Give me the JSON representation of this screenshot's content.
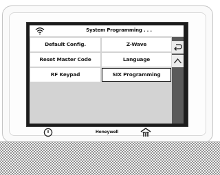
{
  "status_bar": {
    "title": "System Programming . . .",
    "wifi_icon": "wifi-icon"
  },
  "menu": {
    "items": [
      {
        "label": "Default Config.",
        "selected": false
      },
      {
        "label": "Z-Wave",
        "selected": false
      },
      {
        "label": "Reset Master Code",
        "selected": false
      },
      {
        "label": "Language",
        "selected": false
      },
      {
        "label": "RF Keypad",
        "selected": false
      },
      {
        "label": "SIX Programming",
        "selected": true
      }
    ]
  },
  "sidebar": {
    "back_icon": "back-arrow-icon",
    "up_icon": "chevron-up-icon"
  },
  "device_bar": {
    "brand": "Honeywell",
    "power_icon": "power-icon",
    "home_icon": "home-icon"
  },
  "colors": {
    "screen_bg": "#1c1c1c",
    "grid_bg": "#d3d3d3",
    "sidebar_bg": "#5a5a5a",
    "cell_bg": "#ffffff",
    "selected_border": "#111111"
  }
}
